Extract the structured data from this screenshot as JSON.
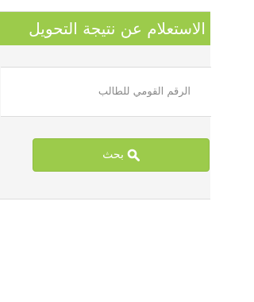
{
  "header": {
    "title": "الاستعلام عن نتيجة التحويل"
  },
  "form": {
    "national_id_placeholder": "الرقم القومي للطالب",
    "national_id_value": "",
    "search_button_label": "بحث",
    "search_icon": "search-icon"
  },
  "colors": {
    "accent": "#9ccb4b",
    "panel_background": "#f5f5f5"
  }
}
